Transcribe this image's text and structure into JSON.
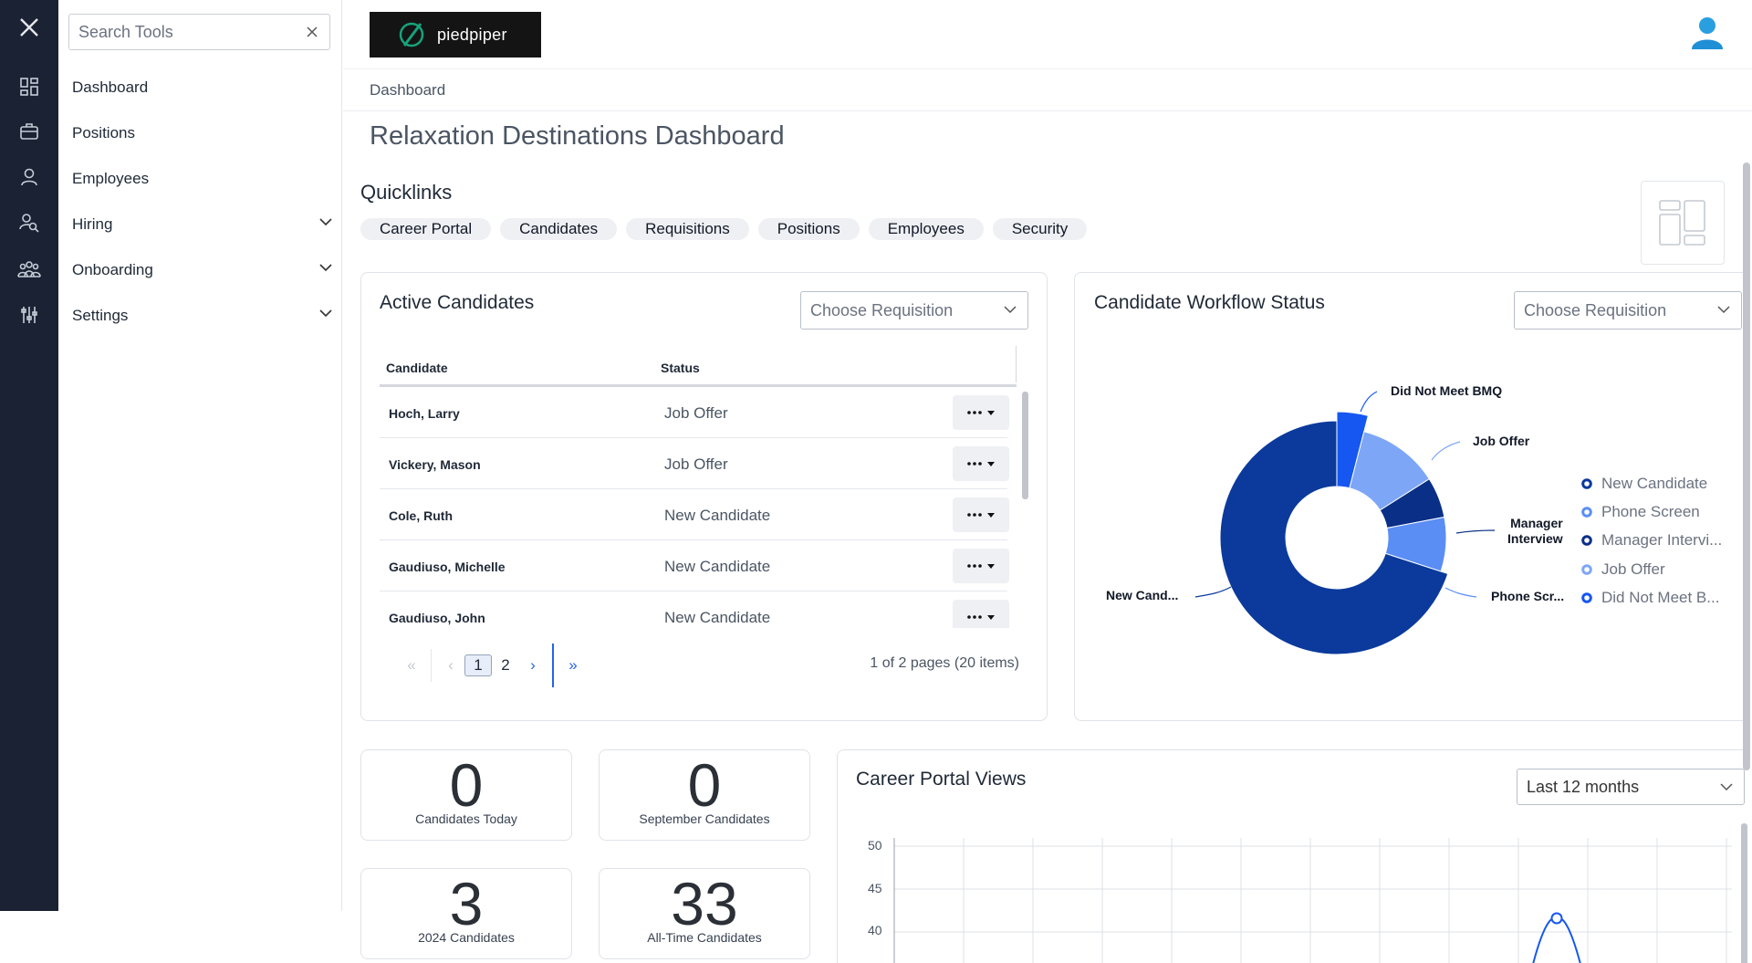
{
  "sidebar": {
    "search_placeholder": "Search Tools",
    "items": [
      {
        "label": "Dashboard"
      },
      {
        "label": "Positions"
      },
      {
        "label": "Employees"
      },
      {
        "label": "Hiring"
      },
      {
        "label": "Onboarding"
      },
      {
        "label": "Settings"
      }
    ]
  },
  "header": {
    "logo_text": "piedpiper"
  },
  "breadcrumb": "Dashboard",
  "page_title": "Relaxation Destinations Dashboard",
  "quicklinks": {
    "title": "Quicklinks",
    "items": [
      "Career Portal",
      "Candidates",
      "Requisitions",
      "Positions",
      "Employees",
      "Security"
    ]
  },
  "active_candidates": {
    "title": "Active Candidates",
    "select_placeholder": "Choose Requisition",
    "columns": [
      "Candidate",
      "Status"
    ],
    "rows": [
      {
        "name": "Hoch, Larry",
        "status": "Job Offer"
      },
      {
        "name": "Vickery, Mason",
        "status": "Job Offer"
      },
      {
        "name": "Cole, Ruth",
        "status": "New Candidate"
      },
      {
        "name": "Gaudiuso, Michelle",
        "status": "New Candidate"
      },
      {
        "name": "Gaudiuso, John",
        "status": "New Candidate"
      }
    ],
    "pager": {
      "first": "«",
      "prev": "‹",
      "pages": [
        "1",
        "2"
      ],
      "next": "›",
      "last": "»",
      "info": "1 of 2 pages (20 items)"
    }
  },
  "workflow": {
    "title": "Candidate Workflow Status",
    "select_placeholder": "Choose Requisition",
    "slice_labels": {
      "did_not_meet": "Did Not Meet BMQ",
      "job_offer": "Job Offer",
      "manager_1": "Manager",
      "manager_2": "Interview",
      "phone": "Phone Scr...",
      "new": "New Cand..."
    },
    "legend": [
      "New Candidate",
      "Phone Screen",
      "Manager Intervi...",
      "Job Offer",
      "Did Not Meet B..."
    ],
    "colors": {
      "new": "#0b3a9c",
      "phone": "#5a8ef5",
      "manager": "#0a2f86",
      "job_offer": "#7ea6f7",
      "did_not_meet": "#1557f0"
    }
  },
  "chart_data": {
    "type": "pie",
    "categories": [
      "New Candidate",
      "Phone Screen",
      "Manager Interview",
      "Job Offer",
      "Did Not Meet BMQ"
    ],
    "values": [
      70,
      8,
      6,
      12,
      4
    ]
  },
  "stats": [
    {
      "value": "0",
      "caption": "Candidates Today"
    },
    {
      "value": "0",
      "caption": "September Candidates"
    },
    {
      "value": "3",
      "caption": "2024 Candidates"
    },
    {
      "value": "33",
      "caption": "All-Time Candidates"
    }
  ],
  "career_portal": {
    "title": "Career Portal Views",
    "select_value": "Last 12 months",
    "y_ticks": [
      "50",
      "45",
      "40"
    ]
  }
}
